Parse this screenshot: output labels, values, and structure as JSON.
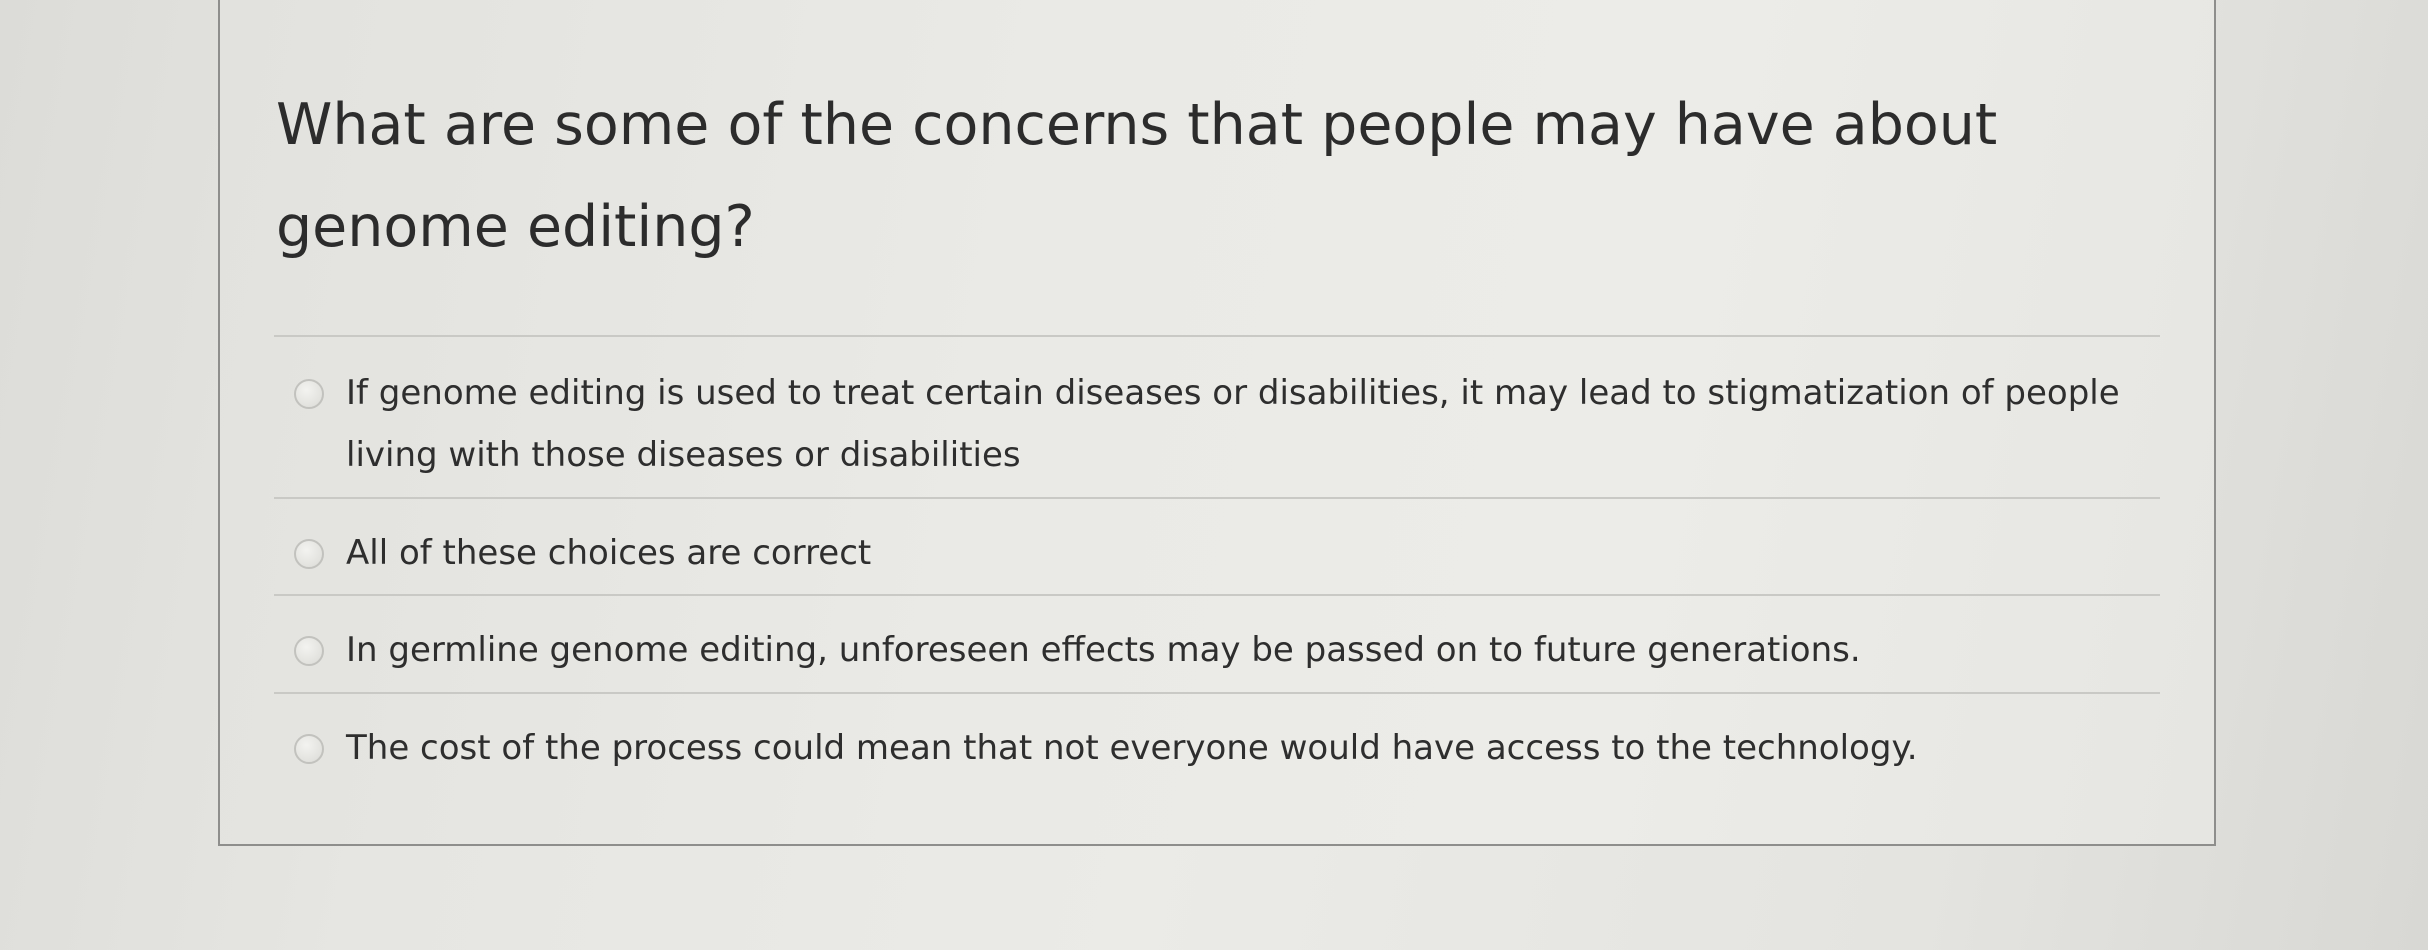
{
  "question": {
    "text": "What are some of the concerns that people may have about genome editing?"
  },
  "options": [
    {
      "label": "If genome editing is used to treat certain diseases or disabilities, it may lead to stigmatization of people living with those diseases or disabilities",
      "selected": false
    },
    {
      "label": "All of these choices are correct",
      "selected": false
    },
    {
      "label": "In germline genome editing, unforeseen effects may be passed on to future generations.",
      "selected": false
    },
    {
      "label": "The cost of the process could mean that not everyone would have access to the technology.",
      "selected": false
    }
  ]
}
